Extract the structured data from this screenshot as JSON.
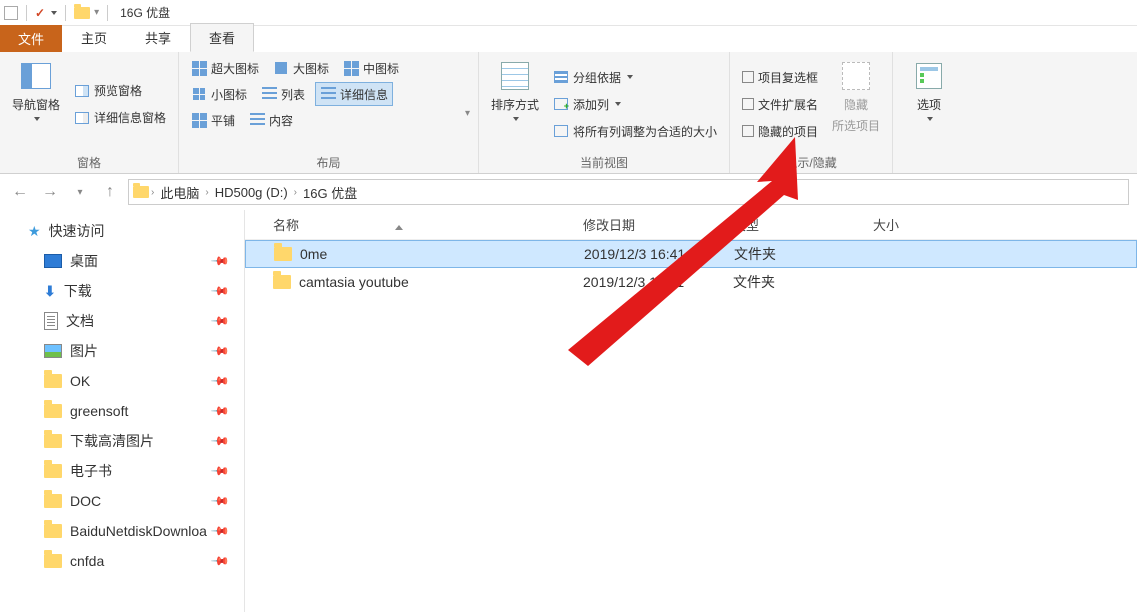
{
  "window": {
    "title": "16G 优盘"
  },
  "tabs": {
    "file": "文件",
    "home": "主页",
    "share": "共享",
    "view": "查看"
  },
  "ribbon": {
    "panes": {
      "nav_pane": "导航窗格",
      "preview_pane": "预览窗格",
      "details_pane": "详细信息窗格",
      "group_label": "窗格"
    },
    "layout": {
      "extra_large": "超大图标",
      "large": "大图标",
      "medium": "中图标",
      "small": "小图标",
      "list": "列表",
      "details": "详细信息",
      "tiles": "平铺",
      "content": "内容",
      "group_label": "布局"
    },
    "current_view": {
      "sort": "排序方式",
      "group_by": "分组依据",
      "add_column": "添加列",
      "autosize": "将所有列调整为合适的大小",
      "group_label": "当前视图"
    },
    "show_hide": {
      "item_checkbox": "项目复选框",
      "file_ext": "文件扩展名",
      "hidden_items": "隐藏的项目",
      "hide_selected": "隐藏",
      "hide_selected_sub": "所选项目",
      "group_label": "显示/隐藏"
    },
    "options": {
      "label": "选项"
    }
  },
  "breadcrumb": {
    "this_pc": "此电脑",
    "drive": "HD500g (D:)",
    "folder": "16G 优盘"
  },
  "sidebar": {
    "quick_access": "快速访问",
    "items": [
      {
        "label": "桌面",
        "icon": "desktop"
      },
      {
        "label": "下载",
        "icon": "download"
      },
      {
        "label": "文档",
        "icon": "doc"
      },
      {
        "label": "图片",
        "icon": "pic"
      },
      {
        "label": "OK",
        "icon": "folder"
      },
      {
        "label": "greensoft",
        "icon": "folder"
      },
      {
        "label": "下载高清图片",
        "icon": "folder"
      },
      {
        "label": "电子书",
        "icon": "folder"
      },
      {
        "label": "DOC",
        "icon": "folder"
      },
      {
        "label": "BaiduNetdiskDownloa",
        "icon": "folder"
      },
      {
        "label": "cnfda",
        "icon": "folder"
      }
    ]
  },
  "columns": {
    "name": "名称",
    "date": "修改日期",
    "type": "类型",
    "size": "大小"
  },
  "rows": [
    {
      "name": "0me",
      "date": "2019/12/3 16:41",
      "type": "文件夹",
      "selected": true
    },
    {
      "name": "camtasia youtube",
      "date": "2019/12/3 16:41",
      "type": "文件夹",
      "selected": false
    }
  ]
}
